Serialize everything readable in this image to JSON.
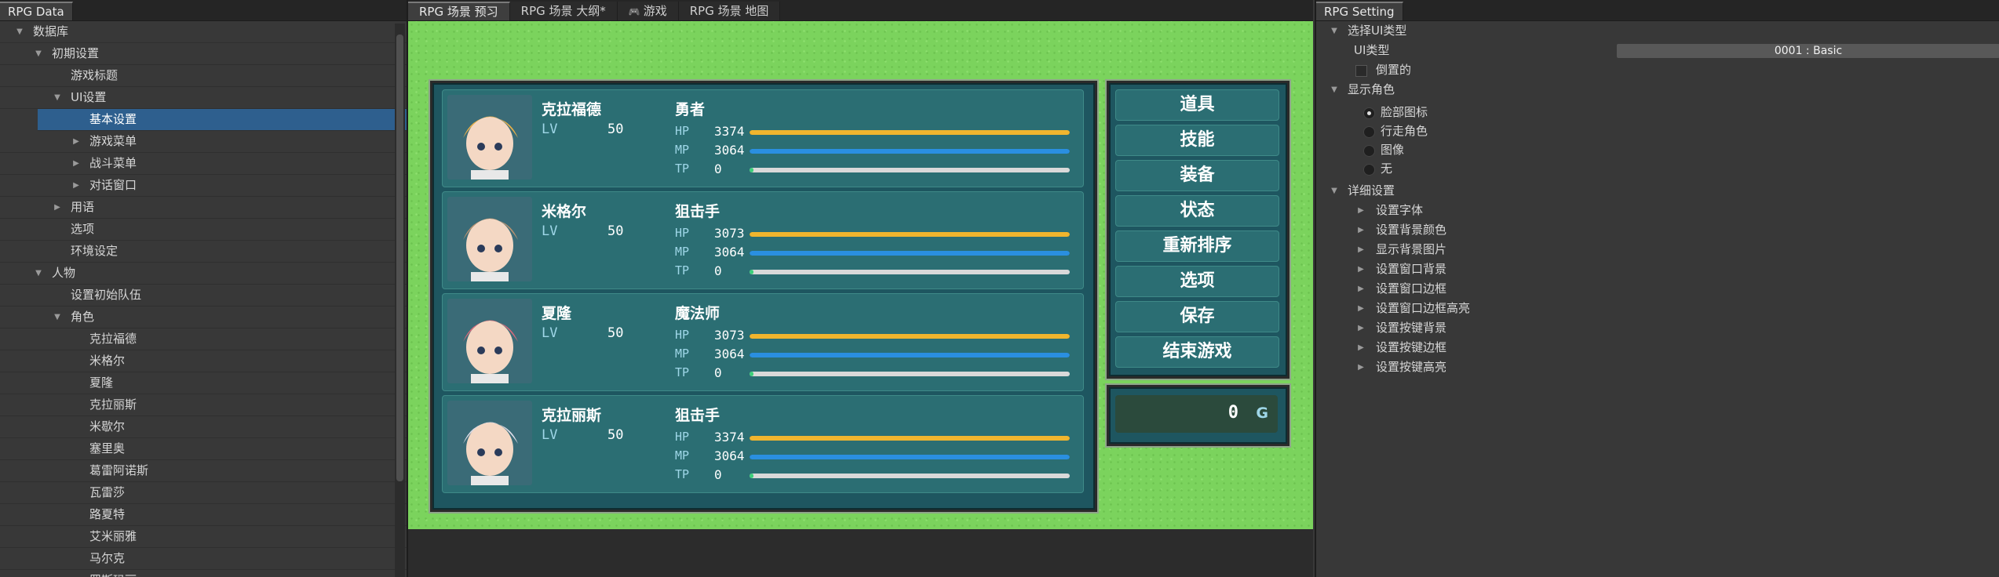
{
  "left_panel": {
    "tab": "RPG Data",
    "tree": [
      {
        "label": "数据库",
        "indent": 0,
        "arrow": "down"
      },
      {
        "label": "初期设置",
        "indent": 1,
        "arrow": "down"
      },
      {
        "label": "游戏标题",
        "indent": 2,
        "arrow": ""
      },
      {
        "label": "UI设置",
        "indent": 2,
        "arrow": "down"
      },
      {
        "label": "基本设置",
        "indent": 3,
        "arrow": "",
        "selected": true
      },
      {
        "label": "游戏菜单",
        "indent": 3,
        "arrow": "right"
      },
      {
        "label": "战斗菜单",
        "indent": 3,
        "arrow": "right"
      },
      {
        "label": "对话窗口",
        "indent": 3,
        "arrow": "right"
      },
      {
        "label": "用语",
        "indent": 2,
        "arrow": "right"
      },
      {
        "label": "选项",
        "indent": 2,
        "arrow": ""
      },
      {
        "label": "环境设定",
        "indent": 2,
        "arrow": ""
      },
      {
        "label": "人物",
        "indent": 1,
        "arrow": "down"
      },
      {
        "label": "设置初始队伍",
        "indent": 2,
        "arrow": ""
      },
      {
        "label": "角色",
        "indent": 2,
        "arrow": "down"
      },
      {
        "label": "克拉福德",
        "indent": 3,
        "arrow": ""
      },
      {
        "label": "米格尔",
        "indent": 3,
        "arrow": ""
      },
      {
        "label": "夏隆",
        "indent": 3,
        "arrow": ""
      },
      {
        "label": "克拉丽斯",
        "indent": 3,
        "arrow": ""
      },
      {
        "label": "米歇尔",
        "indent": 3,
        "arrow": ""
      },
      {
        "label": "塞里奥",
        "indent": 3,
        "arrow": ""
      },
      {
        "label": "葛雷阿诺斯",
        "indent": 3,
        "arrow": ""
      },
      {
        "label": "瓦雷莎",
        "indent": 3,
        "arrow": ""
      },
      {
        "label": "路夏特",
        "indent": 3,
        "arrow": ""
      },
      {
        "label": "艾米丽雅",
        "indent": 3,
        "arrow": ""
      },
      {
        "label": "马尔克",
        "indent": 3,
        "arrow": ""
      },
      {
        "label": "罗斯玛丽",
        "indent": 3,
        "arrow": ""
      }
    ]
  },
  "center_panel": {
    "tabs": [
      {
        "label": "RPG 场景 预习",
        "active": true
      },
      {
        "label": "RPG 场景 大纲*",
        "active": false
      },
      {
        "label": "游戏",
        "active": false,
        "icon": "gamepad-icon"
      },
      {
        "label": "RPG 场景 地图",
        "active": false
      }
    ],
    "game": {
      "actors": [
        {
          "name": "克拉福德",
          "lv_label": "LV",
          "lv": "50",
          "class": "勇者",
          "hp_label": "HP",
          "hp": "3374",
          "hp_ratio": 1.0,
          "mp_label": "MP",
          "mp": "3064",
          "mp_ratio": 1.0,
          "tp_label": "TP",
          "tp": "0",
          "tp_ratio": 0.0,
          "face_color": "#e8b04a",
          "portrait": "blonde-boy-portrait"
        },
        {
          "name": "米格尔",
          "lv_label": "LV",
          "lv": "50",
          "class": "狙击手",
          "hp_label": "HP",
          "hp": "3073",
          "hp_ratio": 1.0,
          "mp_label": "MP",
          "mp": "3064",
          "mp_ratio": 1.0,
          "tp_label": "TP",
          "tp": "0",
          "tp_ratio": 0.0,
          "face_color": "#b79272",
          "portrait": "brown-hair-boy-portrait"
        },
        {
          "name": "夏隆",
          "lv_label": "LV",
          "lv": "50",
          "class": "魔法师",
          "hp_label": "HP",
          "hp": "3073",
          "hp_ratio": 1.0,
          "mp_label": "MP",
          "mp": "3064",
          "mp_ratio": 1.0,
          "tp_label": "TP",
          "tp": "0",
          "tp_ratio": 0.0,
          "face_color": "#d16a7a",
          "portrait": "witch-girl-portrait"
        },
        {
          "name": "克拉丽斯",
          "lv_label": "LV",
          "lv": "50",
          "class": "狙击手",
          "hp_label": "HP",
          "hp": "3374",
          "hp_ratio": 1.0,
          "mp_label": "MP",
          "mp": "3064",
          "mp_ratio": 1.0,
          "tp_label": "TP",
          "tp": "0",
          "tp_ratio": 0.0,
          "face_color": "#dcdbe6",
          "portrait": "silver-hair-girl-portrait"
        }
      ],
      "commands": [
        "道具",
        "技能",
        "装备",
        "状态",
        "重新排序",
        "选项",
        "保存",
        "结束游戏"
      ],
      "gold": {
        "value": "0",
        "unit": "G"
      },
      "colors": {
        "hp": "#f0b52e",
        "mp": "#2a8fe0",
        "tp": "#d9d9d9"
      }
    }
  },
  "right_panel": {
    "tab": "RPG Setting",
    "sections": {
      "ui_type": {
        "header": "选择UI类型",
        "field_label": "UI类型",
        "value": "0001 : Basic",
        "checkbox_label": "倒置的"
      },
      "display_actor": {
        "header": "显示角色",
        "options": [
          "脸部图标",
          "行走角色",
          "图像",
          "无"
        ],
        "selected": "脸部图标"
      },
      "details": {
        "header": "详细设置",
        "items": [
          "设置字体",
          "设置背景颜色",
          "显示背景图片",
          "设置窗口背景",
          "设置窗口边框",
          "设置窗口边框高亮",
          "设置按键背景",
          "设置按键边框",
          "设置按键高亮"
        ]
      }
    }
  }
}
